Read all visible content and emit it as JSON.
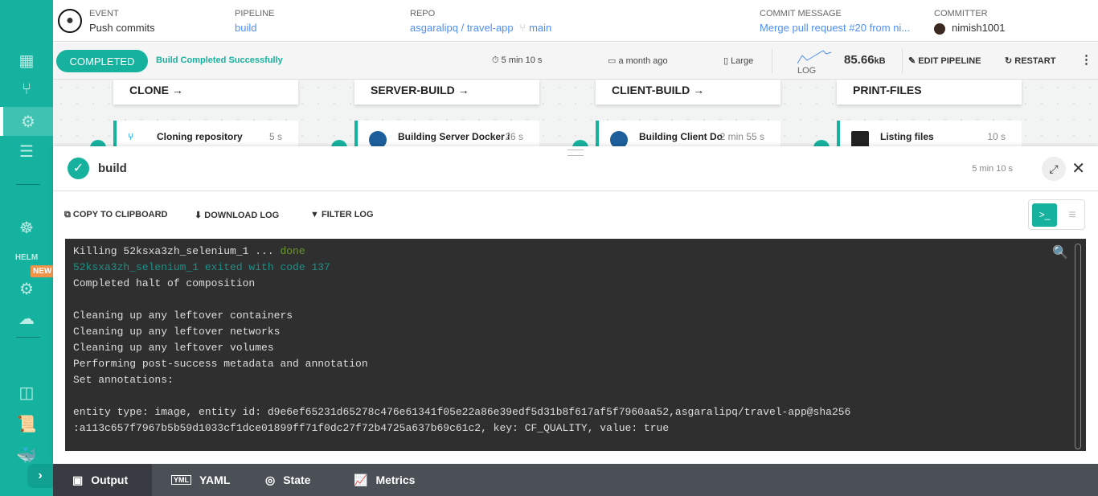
{
  "header": {
    "event_label": "EVENT",
    "event_value": "Push commits",
    "pipeline_label": "PIPELINE",
    "pipeline_value": "build",
    "repo_label": "REPO",
    "repo_value": "asgaralipq / travel-app",
    "branch": "main",
    "commit_label": "COMMIT MESSAGE",
    "commit_value": "Merge pull request #20 from ni...",
    "committer_label": "COMMITTER",
    "committer_value": "nimish1001"
  },
  "status": {
    "badge": "COMPLETED",
    "message": "Build Completed Successfully",
    "duration": "5 min 10 s",
    "when": "a month ago",
    "size": "Large",
    "log_label": "LOG",
    "log_size": "85.66",
    "log_unit": "kB",
    "edit": "EDIT PIPELINE",
    "restart": "RESTART"
  },
  "stages": [
    {
      "name": "CLONE →",
      "step": "Cloning repository",
      "dur": "5 s"
    },
    {
      "name": "SERVER-BUILD →",
      "step": "Building Server Docker i",
      "dur": "26 s"
    },
    {
      "name": "CLIENT-BUILD →",
      "step": "Building Client Do",
      "dur": "2 min 55 s"
    },
    {
      "name": "PRINT-FILES",
      "step": "Listing files",
      "dur": "10 s"
    }
  ],
  "sidebar": {
    "new_badge": "NEW"
  },
  "panel": {
    "title": "build",
    "duration": "5 min 10 s",
    "copy": "COPY TO CLIPBOARD",
    "download": "DOWNLOAD LOG",
    "filter": "FILTER LOG"
  },
  "log": {
    "l1a": "Killing 52ksxa3zh_selenium_1 ... ",
    "l1b": "done",
    "l2": "52ksxa3zh_selenium_1 exited with code 137",
    "l3": "Completed halt of composition",
    "l4": "Cleaning up any leftover containers",
    "l5": "Cleaning up any leftover networks",
    "l6": "Cleaning up any leftover volumes",
    "l7": "Performing post-success metadata and annotation",
    "l8": "Set annotations:",
    "l9": "entity type: image, entity id: d9e6ef65231d65278c476e61341f05e22a86e39edf5d31b8f617af5f7960aa52,asgaralipq/travel-app@sha256",
    "l10": ":a113c657f7967b5b59d1033cf1dce01899ff71f0dc27f72b4725a637b69c61c2, key: CF_QUALITY, value: true"
  },
  "tabs": [
    "Output",
    "YAML",
    "State",
    "Metrics"
  ]
}
